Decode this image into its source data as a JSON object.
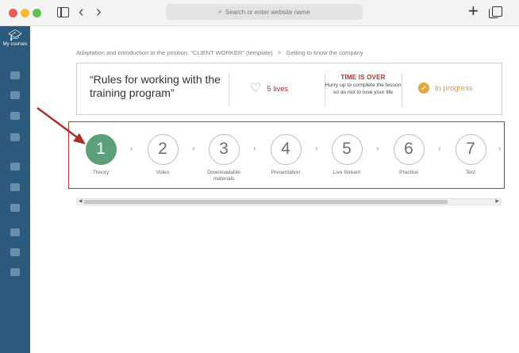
{
  "browser": {
    "address_placeholder": "Search or enter website name",
    "icons": {
      "back": "chevron-left-icon",
      "forward": "chevron-right-icon",
      "new_tab": "plus-icon",
      "tabs": "tabs-icon",
      "sidebar": "sidebar-icon"
    }
  },
  "app_sidebar": {
    "title": "My courses",
    "icon": "graduation-cap-icon"
  },
  "breadcrumb": {
    "course": "Adaptation and introduction to the position: \"CLIENT WORKER\" (template)",
    "separator": ">",
    "lesson": "Getting to know the company"
  },
  "lesson_card": {
    "title": "“Rules for working with the training program”",
    "lives_label": "5 lives",
    "time_over_title": "TIME IS OVER",
    "time_over_text": "Hurry up to complete the lesson so as not to lose your life",
    "status_label": "In progress"
  },
  "steps": [
    {
      "number": "1",
      "label": "Theory",
      "active": true
    },
    {
      "number": "2",
      "label": "Video",
      "active": false
    },
    {
      "number": "3",
      "label": "Downloadable materials",
      "active": false
    },
    {
      "number": "4",
      "label": "Presentation",
      "active": false
    },
    {
      "number": "5",
      "label": "Live Stream",
      "active": false
    },
    {
      "number": "6",
      "label": "Practice",
      "active": false
    },
    {
      "number": "7",
      "label": "Test",
      "active": false
    }
  ],
  "colors": {
    "sidebar_bg": "#2c5a7c",
    "active_step": "#5c9f79",
    "highlight_border": "#b23a30",
    "lives_color": "#aa3333",
    "status_color": "#d89a2a"
  }
}
